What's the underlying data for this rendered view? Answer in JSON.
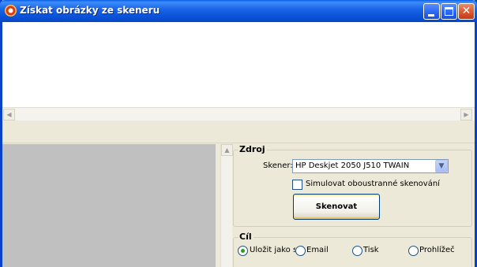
{
  "window": {
    "title": "Získat obrázky ze skeneru"
  },
  "source_group": {
    "legend": "Zdroj",
    "scanner_label": "Skener:",
    "scanner_value": "HP Deskjet 2050 J510 TWAIN",
    "duplex_label": "Simulovat oboustranné skenování",
    "duplex_checked": false,
    "scan_button": "Skenovat"
  },
  "target_group": {
    "legend": "Cíl",
    "options": [
      {
        "label": "Uložit jako sou",
        "selected": true
      },
      {
        "label": "Email",
        "selected": false
      },
      {
        "label": "Tisk",
        "selected": false
      },
      {
        "label": "Prohlížeč",
        "selected": false
      }
    ]
  },
  "icons": {
    "app": "scanner-app-icon",
    "minimize": "minimize-icon",
    "maximize": "maximize-icon",
    "close": "close-icon",
    "dropdown": "chevron-down-icon"
  },
  "colors": {
    "titlebar": "#0a52d8",
    "window_bg": "#ece9d8",
    "thumbnail_area": "#c0c0c0",
    "radio_selected": "#21a121"
  }
}
